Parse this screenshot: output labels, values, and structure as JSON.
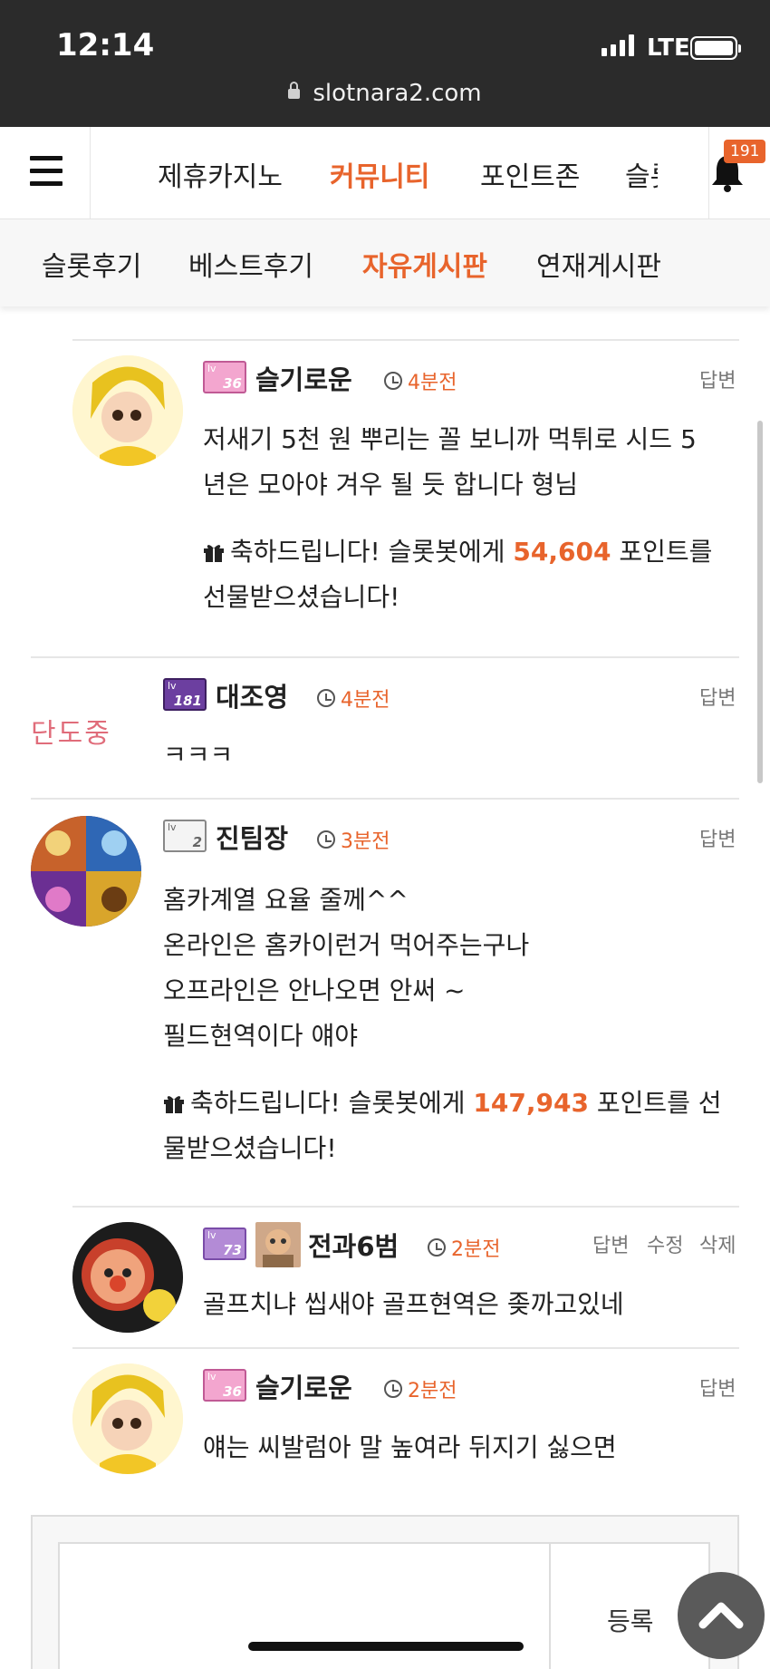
{
  "status_bar": {
    "time": "12:14",
    "network": "LTE",
    "url": "slotnara2.com"
  },
  "top_nav": {
    "items": [
      {
        "label": "제휴카지노",
        "active": false
      },
      {
        "label": "커뮤니티",
        "active": true
      },
      {
        "label": "포인트존",
        "active": false
      },
      {
        "label": "슬롯",
        "active": false
      }
    ],
    "notification_count": "191",
    "accent": "#e8642c"
  },
  "sub_nav": {
    "items": [
      {
        "label": "슬롯후기",
        "active": false
      },
      {
        "label": "베스트후기",
        "active": false
      },
      {
        "label": "자유게시판",
        "active": true
      },
      {
        "label": "연재게시판",
        "active": false
      }
    ]
  },
  "comments": [
    {
      "user": "슬기로운",
      "level": "36",
      "time": "4분전",
      "actions": [
        "답변"
      ],
      "lines": [
        "저새기 5천 원 뿌리는 꼴 보니까 먹튀로 시드 5",
        "년은 모아야 겨우 될 듯 합니다 형님"
      ],
      "gift": {
        "prefix": "축하드립니다! 슬롯봇에게 ",
        "points": "54,604",
        "suffix": " 포인트를",
        "line2": "선물받으셨습니다!"
      }
    },
    {
      "user": "대조영",
      "level": "181",
      "time": "4분전",
      "actions": [
        "답변"
      ],
      "avatar_text": "단도중",
      "lines": [
        "ㅋㅋㅋ"
      ]
    },
    {
      "user": "진팀장",
      "level": "2",
      "time": "3분전",
      "actions": [
        "답변"
      ],
      "lines": [
        "홈카계열 요율 줄께^^",
        "온라인은 홈카이런거 먹어주는구나",
        "오프라인은 안나오면 안써 ~",
        "필드현역이다 얘야"
      ],
      "gift": {
        "prefix": "축하드립니다! 슬롯봇에게 ",
        "points": "147,943",
        "suffix": " 포인트를 선",
        "line2": "물받으셨습니다!"
      }
    },
    {
      "user": "전과6범",
      "level": "73",
      "time": "2분전",
      "actions": [
        "답변",
        "수정",
        "삭제"
      ],
      "lines": [
        "골프치냐 씹새야 골프현역은 좆까고있네"
      ]
    },
    {
      "user": "슬기로운",
      "level": "36",
      "time": "2분전",
      "actions": [
        "답변"
      ],
      "lines": [
        "얘는 씨발럼아 말 높여라 뒤지기 싫으면"
      ]
    }
  ],
  "composer": {
    "submit_label": "등록"
  }
}
